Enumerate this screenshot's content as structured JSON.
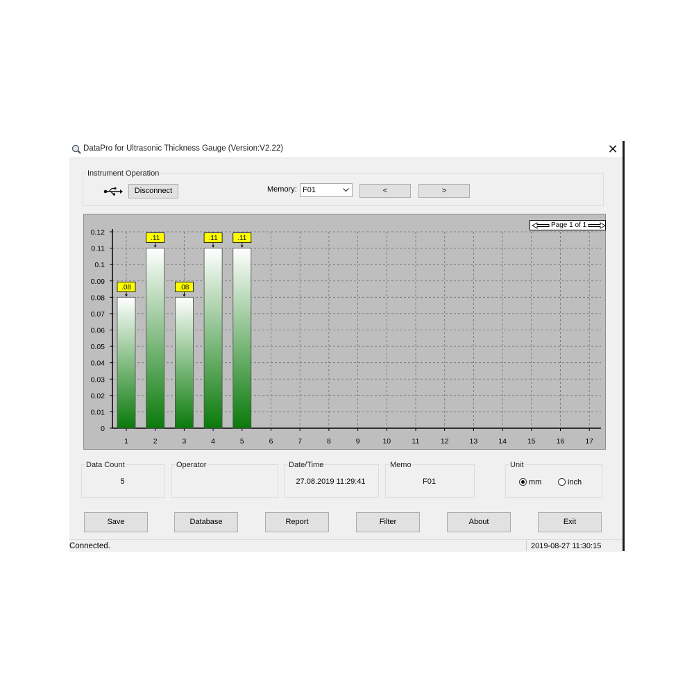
{
  "window": {
    "title": "DataPro for Ultrasonic Thickness Gauge (Version:V2.22)",
    "close_glyph": "✕"
  },
  "instrument": {
    "group_label": "Instrument Operation",
    "usb_icon": "usb-icon",
    "disconnect_label": "Disconnect",
    "memory_label": "Memory:",
    "memory_value": "F01",
    "prev_label": "<",
    "next_label": ">"
  },
  "pager": {
    "text": "Page 1 of 1"
  },
  "chart_data": {
    "type": "bar",
    "categories": [
      "1",
      "2",
      "3",
      "4",
      "5",
      "6",
      "7",
      "8",
      "9",
      "10",
      "11",
      "12",
      "13",
      "14",
      "15",
      "16",
      "17"
    ],
    "values": [
      0.08,
      0.11,
      0.08,
      0.11,
      0.11,
      null,
      null,
      null,
      null,
      null,
      null,
      null,
      null,
      null,
      null,
      null,
      null
    ],
    "data_labels": [
      ".08",
      ".11",
      ".08",
      ".11",
      ".11"
    ],
    "yticks": [
      "0.12",
      "0.11",
      "0.1",
      "0.09",
      "0.08",
      "0.07",
      "0.06",
      "0.05",
      "0.04",
      "0.03",
      "0.02",
      "0.01",
      "0"
    ],
    "ylim": [
      0,
      0.12
    ],
    "grid": true,
    "colors": {
      "bar_top": "#ffffff",
      "bar_bottom": "#0a7a0a",
      "label_bg": "#ffff00",
      "plot_bg": "#bebebe"
    }
  },
  "info": {
    "data_count_label": "Data Count",
    "data_count_value": "5",
    "operator_label": "Operator",
    "operator_value": "",
    "datetime_label": "Date/Time",
    "datetime_value": "27.08.2019 11:29:41",
    "memo_label": "Memo",
    "memo_value": "F01",
    "unit_label": "Unit",
    "unit_mm": "mm",
    "unit_inch": "inch",
    "unit_selected": "mm"
  },
  "buttons": {
    "save": "Save",
    "database": "Database",
    "report": "Report",
    "filter": "Filter",
    "about": "About",
    "exit": "Exit"
  },
  "status": {
    "left": "Connected.",
    "right": "2019-08-27 11:30:15"
  }
}
